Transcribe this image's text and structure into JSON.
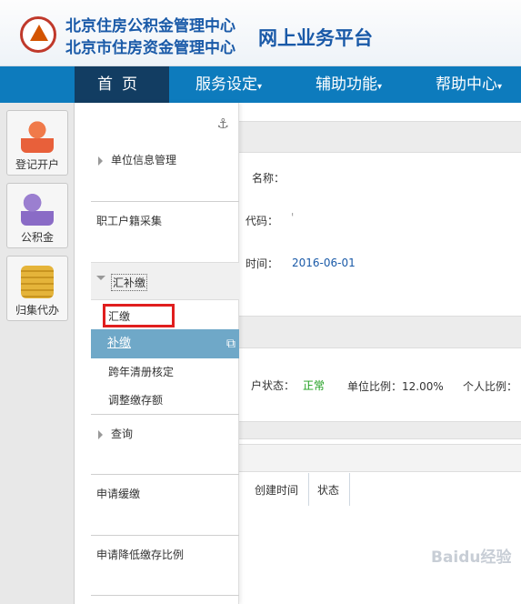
{
  "header": {
    "org_line1": "北京住房公积金管理中心",
    "org_line2": "北京市住房资金管理中心",
    "platform": "网上业务平台"
  },
  "nav": {
    "home": "首页",
    "service": "服务设定",
    "aux": "辅助功能",
    "help": "帮助中心",
    "caret": "▾"
  },
  "quick_tiles": [
    {
      "label": "登记开户",
      "icon": "user-edit-icon"
    },
    {
      "label": "公积金",
      "icon": "users-icon"
    },
    {
      "label": "归集代办",
      "icon": "coins-icon"
    }
  ],
  "dropdown": {
    "anchor_icon": "⚓",
    "unit_info": "单位信息管理",
    "staff_collect": "职工户籍采集",
    "supplement_group": "汇补缴",
    "sub_items": [
      "汇缴",
      "补缴",
      "跨年清册核定",
      "调整缴存额"
    ],
    "query": "查询",
    "apply_postpone": "申请缓缴",
    "apply_reduce": "申请降低缴存比例",
    "ext_icon": "⧉"
  },
  "background": {
    "name_label": "名称：",
    "code_label": "代码：",
    "time_label": "时间：",
    "time_value": "2016-06-01",
    "account_status_label": "户状态：",
    "account_status_value": "正常",
    "unit_ratio": "单位比例：12.00%",
    "personal_ratio": "个人比例：",
    "create_time_col": "创建时间",
    "status_col": "状态"
  },
  "colors": {
    "nav_bg": "#0d7bbd",
    "nav_active": "#123d62",
    "selected_bg": "#6fa8c8",
    "highlight_box": "#e01e1e",
    "status_ok": "#1e9e1e",
    "link_blue": "#1a5aa8"
  },
  "watermark": "Baidu经验"
}
